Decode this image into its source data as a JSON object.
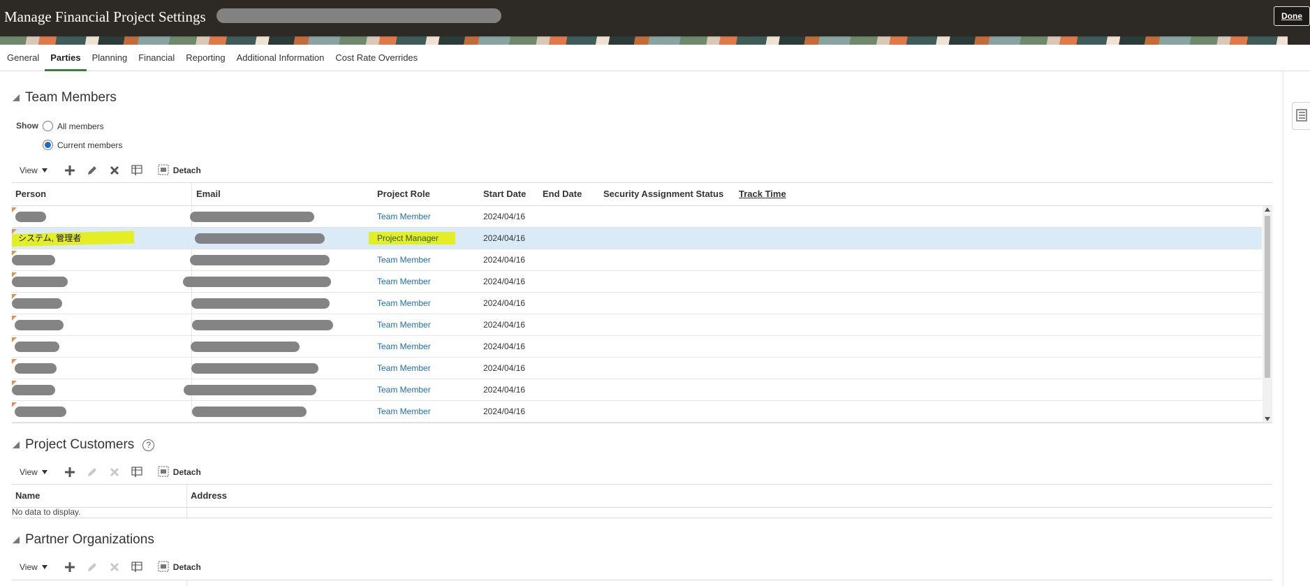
{
  "header": {
    "title": "Manage Financial Project Settings",
    "done_label": "Done"
  },
  "tabs": [
    {
      "label": "General",
      "active": false
    },
    {
      "label": "Parties",
      "active": true
    },
    {
      "label": "Planning",
      "active": false
    },
    {
      "label": "Financial",
      "active": false
    },
    {
      "label": "Reporting",
      "active": false
    },
    {
      "label": "Additional Information",
      "active": false
    },
    {
      "label": "Cost Rate Overrides",
      "active": false
    }
  ],
  "team_members": {
    "title": "Team Members",
    "show_label": "Show",
    "filter_options": [
      {
        "label": "All members",
        "selected": false
      },
      {
        "label": "Current members",
        "selected": true
      }
    ],
    "toolbar": {
      "view_label": "View",
      "detach_label": "Detach"
    },
    "columns": [
      "Person",
      "Email",
      "Project Role",
      "Start Date",
      "End Date",
      "Security Assignment Status",
      "Track Time"
    ],
    "rows": [
      {
        "person": "",
        "role": "Team Member",
        "start": "2024/04/16",
        "selected": false
      },
      {
        "person": "システム, 管理者",
        "role": "Project Manager",
        "start": "2024/04/16",
        "selected": true
      },
      {
        "person": "",
        "role": "Team Member",
        "start": "2024/04/16",
        "selected": false
      },
      {
        "person": "",
        "role": "Team Member",
        "start": "2024/04/16",
        "selected": false
      },
      {
        "person": "",
        "role": "Team Member",
        "start": "2024/04/16",
        "selected": false
      },
      {
        "person": "",
        "role": "Team Member",
        "start": "2024/04/16",
        "selected": false
      },
      {
        "person": "",
        "role": "Team Member",
        "start": "2024/04/16",
        "selected": false
      },
      {
        "person": "",
        "role": "Team Member",
        "start": "2024/04/16",
        "selected": false
      },
      {
        "person": "",
        "role": "Team Member",
        "start": "2024/04/16",
        "selected": false
      },
      {
        "person": "",
        "role": "Team Member",
        "start": "2024/04/16",
        "selected": false
      }
    ]
  },
  "project_customers": {
    "title": "Project Customers",
    "toolbar": {
      "view_label": "View",
      "detach_label": "Detach"
    },
    "columns": [
      "Name",
      "Address"
    ],
    "empty_text": "No data to display."
  },
  "partner_organizations": {
    "title": "Partner Organizations",
    "toolbar": {
      "view_label": "View",
      "detach_label": "Detach"
    }
  },
  "colors": {
    "header_bg": "#2d2a26",
    "active_tab_underline": "#3b7d3b",
    "link": "#1f6ea8",
    "selected_row": "#dbeaf7",
    "highlight": "#e4ee00"
  },
  "icons": [
    "add-icon",
    "edit-icon",
    "delete-icon",
    "freeze-icon",
    "detach-icon",
    "help-icon",
    "panel-icon"
  ]
}
